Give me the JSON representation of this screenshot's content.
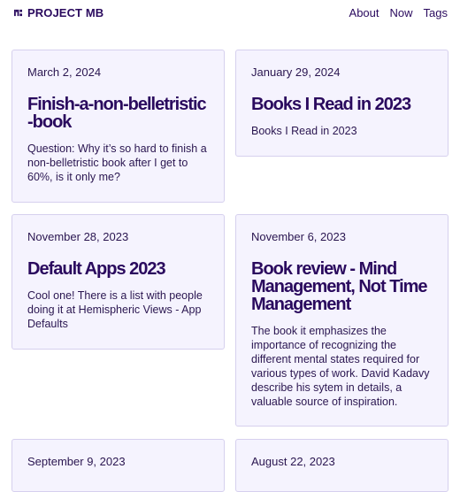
{
  "header": {
    "brand": "PROJECT MB",
    "nav": [
      "About",
      "Now",
      "Tags"
    ]
  },
  "posts": [
    {
      "date": "March 2, 2024",
      "title": "Finish-a-non-belletristic-book",
      "excerpt": "Question: Why it’s so hard to finish a non-belletristic book after I get to 60%, is it only me?"
    },
    {
      "date": "January 29, 2024",
      "title": "Books I Read in 2023",
      "excerpt": "Books I Read in 2023"
    },
    {
      "date": "November 28, 2023",
      "title": "Default Apps 2023",
      "excerpt": "Cool one! There is a list with people doing it at Hemispheric Views - App Defaults"
    },
    {
      "date": "November 6, 2023",
      "title": "Book review - Mind Management, Not Time Management",
      "excerpt": "The book it emphasizes the importance of recognizing the different mental states required for various types of work. David Kadavy describe his sytem in details, a valuable source of inspiration."
    },
    {
      "date": "September 9, 2023",
      "title": "",
      "excerpt": ""
    },
    {
      "date": "August 22, 2023",
      "title": "",
      "excerpt": ""
    }
  ],
  "colors": {
    "accent": "#2a0a5e",
    "card_bg": "#f5f3fe",
    "card_border": "#d6d0ee"
  }
}
